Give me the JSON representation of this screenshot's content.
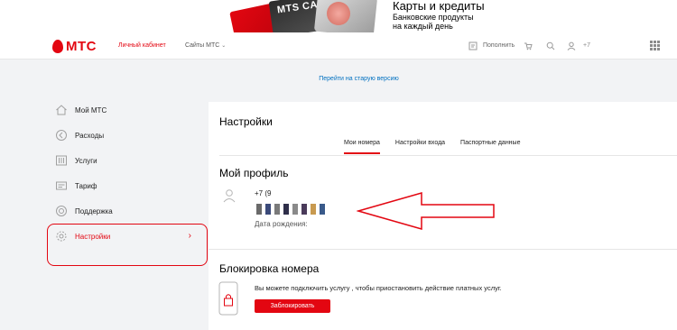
{
  "banner": {
    "card_text": "MTS CASH",
    "title": "Карты и кредиты",
    "subtitle_line1": "Банковские продукты",
    "subtitle_line2": "на каждый день"
  },
  "header": {
    "logo_text": "МТС",
    "lk_label": "Личный кабинет",
    "sites_label": "Сайты МТС",
    "topup_label": "Пополнить",
    "phone_prefix": "+7"
  },
  "old_version_link": "Перейти на старую версию",
  "sidebar": {
    "items": [
      {
        "label": "Мой МТС",
        "icon": "home-icon"
      },
      {
        "label": "Расходы",
        "icon": "expenses-icon"
      },
      {
        "label": "Услуги",
        "icon": "services-icon"
      },
      {
        "label": "Тариф",
        "icon": "tariff-icon"
      },
      {
        "label": "Поддержка",
        "icon": "support-icon"
      },
      {
        "label": "Настройки",
        "icon": "gear-icon",
        "active": true
      }
    ]
  },
  "main": {
    "title": "Настройки",
    "tabs": [
      {
        "label": "Мои номера",
        "active": true
      },
      {
        "label": "Настройки входа"
      },
      {
        "label": "Паспортные данные"
      }
    ],
    "profile": {
      "title": "Мой профиль",
      "phone": "+7 (9",
      "birth_label": "Дата рождения:"
    },
    "block": {
      "title": "Блокировка номера",
      "description": "Вы можете подключить услугу , чтобы приостановить действие платных услуг.",
      "button_label": "Заблокировать"
    }
  },
  "colors": {
    "accent": "#e30611",
    "link": "#0070c0",
    "background": "#f2f3f5"
  }
}
